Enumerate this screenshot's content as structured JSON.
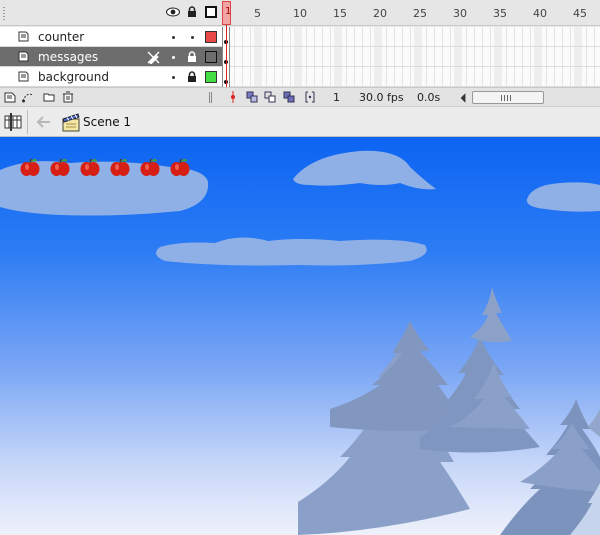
{
  "timeline": {
    "frame_numbers": [
      "1",
      "5",
      "10",
      "15",
      "20",
      "25",
      "30",
      "35",
      "40",
      "45"
    ],
    "layers": [
      {
        "name": "counter",
        "color": "#e84a4a",
        "selected": false,
        "locked": false
      },
      {
        "name": "messages",
        "color": "#6d6d6d",
        "selected": true,
        "locked": true
      },
      {
        "name": "background",
        "color": "#44dd44",
        "selected": false,
        "locked": true
      }
    ],
    "footer": {
      "current_frame": "1",
      "frame_rate": "30.0 fps",
      "elapsed_time": "0.0s"
    }
  },
  "editbar": {
    "scene_name": "Scene 1"
  },
  "stage": {
    "sky_colors": [
      "#0c64f2",
      "#7aa6f5",
      "#eef1fb"
    ],
    "cloud_color": "#8fb0e6",
    "tree_color": "#8aa0c8",
    "apple_count": 6,
    "apple_color": "#d61f14"
  }
}
